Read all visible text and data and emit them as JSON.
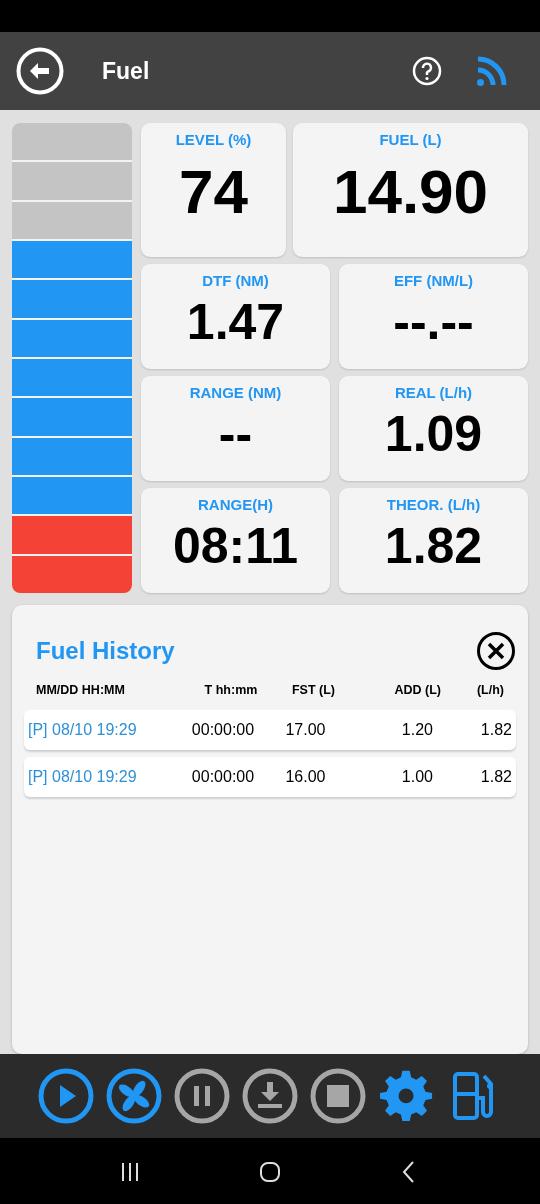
{
  "header": {
    "title": "Fuel"
  },
  "gauge": {
    "level": 0.74
  },
  "tile_rows": [
    [
      {
        "label": "LEVEL (%)",
        "value": "74"
      },
      {
        "label": "FUEL (L)",
        "value": "14.90"
      }
    ],
    [
      {
        "label": "DTF (NM)",
        "value": "1.47"
      },
      {
        "label": "EFF (NM/L)",
        "value": "--.--"
      }
    ],
    [
      {
        "label": "RANGE (NM)",
        "value": "--"
      },
      {
        "label": "REAL (L/h)",
        "value": "1.09"
      }
    ],
    [
      {
        "label": "RANGE(H)",
        "value": "08:11"
      },
      {
        "label": "THEOR. (L/h)",
        "value": "1.82"
      }
    ]
  ],
  "history": {
    "title": "Fuel History",
    "columns": [
      "MM/DD HH:MM",
      "T hh:mm",
      "FST (L)",
      "ADD (L)",
      "(L/h)"
    ],
    "rows": [
      [
        "[P] 08/10 19:29",
        "00:00:00",
        "17.00",
        "1.20",
        "1.82"
      ],
      [
        "[P] 08/10 19:29",
        "00:00:00",
        "16.00",
        "1.00",
        "1.82"
      ]
    ]
  },
  "toolbar": [
    {
      "kind": "play",
      "active": true
    },
    {
      "kind": "fan",
      "active": true
    },
    {
      "kind": "pause",
      "active": false
    },
    {
      "kind": "download",
      "active": false
    },
    {
      "kind": "stop",
      "active": false
    },
    {
      "kind": "settings",
      "active": true
    },
    {
      "kind": "fuel",
      "active": true
    }
  ]
}
